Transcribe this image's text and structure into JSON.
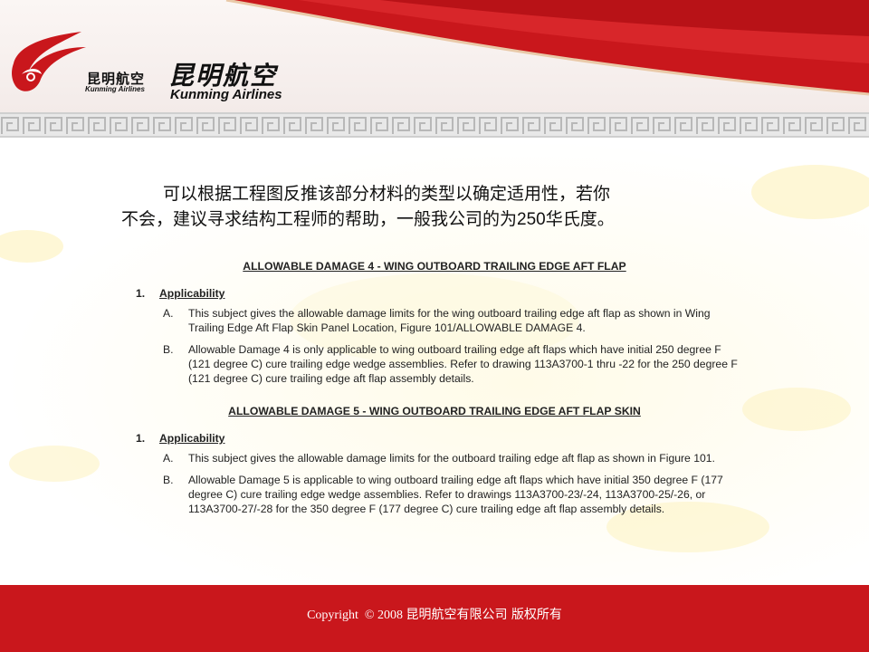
{
  "brand": {
    "name_cn": "昆明航空",
    "name_en": "Kunming Airlines",
    "small_cn": "昆明航空",
    "small_en": "Kunming Airlines",
    "colors": {
      "brand_red": "#c9171c",
      "gold": "#d8b23a"
    }
  },
  "intro": {
    "line1": "可以根据工程图反推该部分材料的类型以确定适用性，若你",
    "line2_pre": "不会，建议寻求结构工程师的帮助，一般我公司的为",
    "line2_num": "250",
    "line2_post": "华氏度。"
  },
  "sections": [
    {
      "title": "ALLOWABLE DAMAGE 4 - WING OUTBOARD TRAILING EDGE AFT FLAP",
      "heading_num": "1.",
      "heading": "Applicability",
      "items": [
        {
          "letter": "A.",
          "text": "This subject gives the allowable damage limits for the wing outboard trailing edge aft flap as shown in Wing Trailing Edge Aft Flap Skin Panel Location, Figure 101/ALLOWABLE DAMAGE 4."
        },
        {
          "letter": "B.",
          "text": "Allowable Damage 4 is only applicable to wing outboard trailing edge aft flaps which have initial 250 degree F (121 degree C) cure trailing edge wedge assemblies. Refer to drawing 113A3700-1 thru -22 for the 250 degree F (121 degree C) cure trailing edge aft flap assembly details."
        }
      ]
    },
    {
      "title": "ALLOWABLE DAMAGE 5 - WING OUTBOARD TRAILING EDGE AFT FLAP SKIN",
      "heading_num": "1.",
      "heading": "Applicability",
      "items": [
        {
          "letter": "A.",
          "text": "This subject gives the allowable damage limits for the outboard trailing edge aft flap as shown in Figure 101."
        },
        {
          "letter": "B.",
          "text": "Allowable Damage 5 is applicable to wing outboard trailing edge aft flaps which have initial 350 degree F (177 degree C) cure trailing edge wedge assemblies. Refer to drawings 113A3700-23/-24, 113A3700-25/-26, or 113A3700-27/-28 for the 350 degree F (177 degree C) cure trailing edge aft flap assembly details."
        }
      ]
    }
  ],
  "footer": {
    "copyright_prefix": "Copyright  © 2008 ",
    "copyright_cn": "昆明航空有限公司 版权所有"
  }
}
